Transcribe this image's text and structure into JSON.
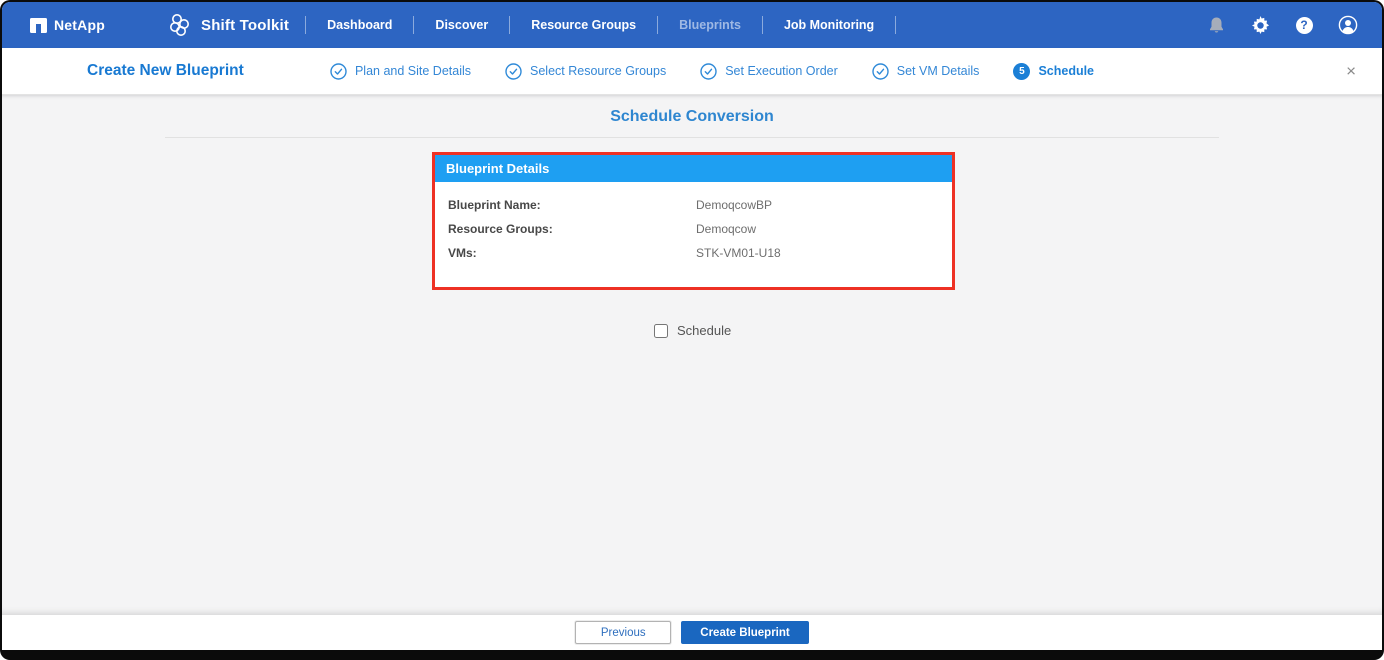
{
  "navbar": {
    "brand": "NetApp",
    "product": "Shift Toolkit",
    "items": [
      {
        "label": "Dashboard",
        "muted": false
      },
      {
        "label": "Discover",
        "muted": false
      },
      {
        "label": "Resource Groups",
        "muted": false
      },
      {
        "label": "Blueprints",
        "muted": true
      },
      {
        "label": "Job Monitoring",
        "muted": false
      }
    ],
    "icons": [
      "bell-icon",
      "gear-icon",
      "help-icon",
      "account-icon"
    ]
  },
  "wizard": {
    "title": "Create New Blueprint",
    "steps": [
      {
        "label": "Plan and Site Details",
        "state": "done"
      },
      {
        "label": "Select Resource Groups",
        "state": "done"
      },
      {
        "label": "Set Execution Order",
        "state": "done"
      },
      {
        "label": "Set VM Details",
        "state": "done"
      },
      {
        "label": "Schedule",
        "state": "current",
        "number": "5"
      }
    ],
    "close_label": "×"
  },
  "main": {
    "heading": "Schedule Conversion",
    "details_panel": {
      "title": "Blueprint Details",
      "rows": [
        {
          "label": "Blueprint Name:",
          "value": "DemoqcowBP"
        },
        {
          "label": "Resource Groups:",
          "value": "Demoqcow"
        },
        {
          "label": "VMs:",
          "value": "STK-VM01-U18"
        }
      ]
    },
    "schedule_checkbox_label": "Schedule",
    "schedule_checked": false
  },
  "footer": {
    "previous_label": "Previous",
    "create_label": "Create Blueprint"
  },
  "colors": {
    "navbar_blue": "#2d65c2",
    "accent_blue": "#1879d2",
    "panel_header_blue": "#1e9ff2",
    "annotation_red": "#ee3124",
    "primary_button_blue": "#1a67c0",
    "content_background": "#f4f4f5"
  }
}
